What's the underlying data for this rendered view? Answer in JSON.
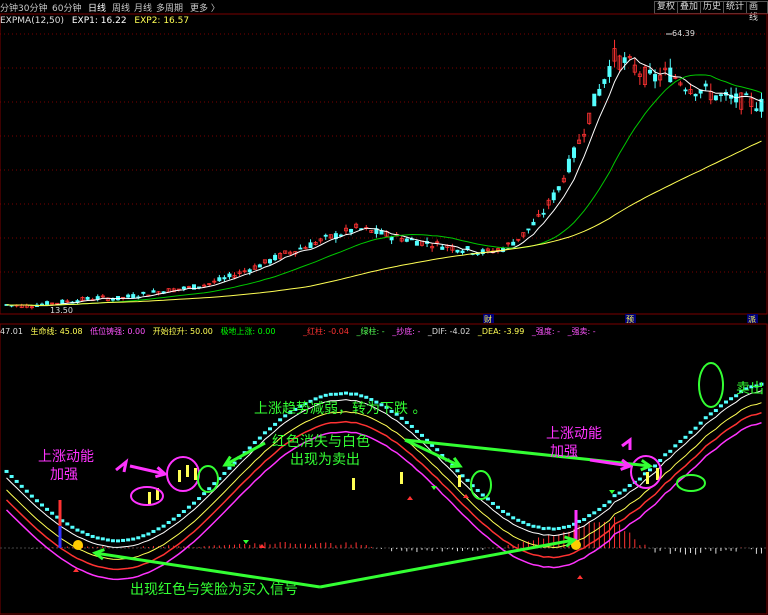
{
  "toolbar": {
    "tabs": [
      "分钟",
      "30分钟",
      "60分钟",
      "日线",
      "周线",
      "月线",
      "多周期",
      "更多 〉"
    ],
    "active_tab": "日线",
    "buttons": [
      "复权",
      "叠加",
      "历史",
      "统计",
      "画线"
    ]
  },
  "main_legend": {
    "expma": "EXPMA(12,50)",
    "exp1": "EXP1: 16.22",
    "exp2": "EXP2: 16.57"
  },
  "price_labels": {
    "high": "64.39",
    "low": "13.50"
  },
  "markers": [
    "财",
    "预",
    "派"
  ],
  "sub_legend": {
    "v0": "47.01",
    "life_line": "生命线: 45.08",
    "bottom_accum": "低位铸强: 0.00",
    "start_pull": "开始拉升: 50.00",
    "bottom_up": "极地上涨: 0.00",
    "red_col": "_红柱: -0.04",
    "green_col": "_绿柱: -",
    "smile": "_抄底: -",
    "dif": "_DIF: -4.02",
    "dea": "_DEA: -3.99",
    "strong": "_强度: -",
    "sell": "_强卖: -"
  },
  "annotations": {
    "up_strong_1": "上涨动能\n加强",
    "trend_weak": "上涨趋势减弱，转为下跌",
    "red_gone": "红色消失与白色\n出现为卖出",
    "up_strong_2": "上涨动能\n加强",
    "sell": "卖出",
    "buy_signal": "出现红色与笑脸为买入信号"
  },
  "colors": {
    "up": "#ff3232",
    "down": "#54ffff",
    "ma_white": "#ffffff",
    "ma_yellow": "#ffff54",
    "ma_green": "#00c800",
    "grid": "#7a0000",
    "annotation_green": "#33ff33",
    "annotation_magenta": "#ff33ff"
  },
  "chart_data": {
    "type": "candlestick",
    "price_range": [
      13.5,
      64.39
    ],
    "close_series": [
      14.1,
      13.9,
      14.2,
      14.6,
      15.0,
      15.4,
      15.2,
      15.8,
      16.4,
      16.9,
      17.3,
      18.0,
      19.1,
      20.5,
      21.8,
      23.4,
      24.6,
      25.9,
      27.1,
      28.3,
      27.6,
      26.8,
      26.1,
      25.5,
      24.9,
      24.3,
      23.8,
      24.6,
      26.9,
      30.4,
      35.8,
      43.5,
      52.4,
      60.1,
      58.3,
      55.9,
      57.2,
      54.8,
      53.6,
      52.4,
      51.9,
      51.2
    ],
    "sub_indicators": {
      "dif": -4.02,
      "dea": -3.99,
      "life_line": 45.08,
      "start_pull": 50.0
    }
  }
}
